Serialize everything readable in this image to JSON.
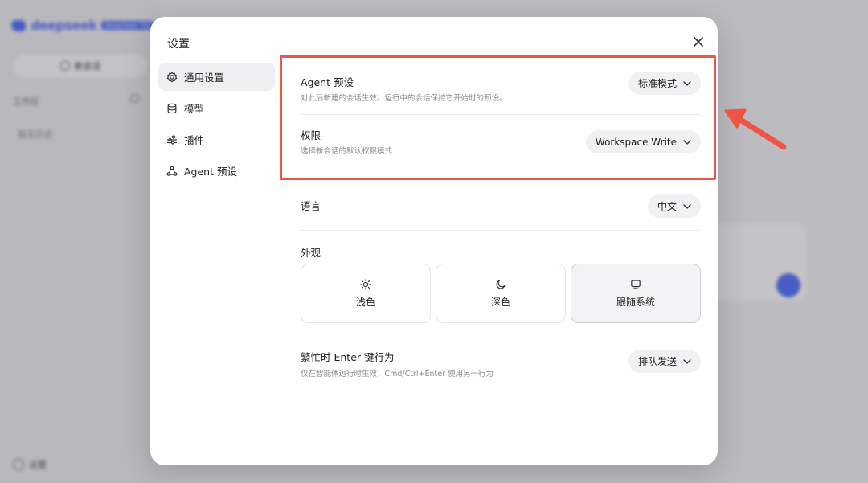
{
  "background": {
    "logo_text": "deepseek",
    "logo_badge": "DeepSeek TUI",
    "new_chat": "新会话",
    "workspace": "工作区",
    "empty": "暂无历史",
    "settings": "设置"
  },
  "modal": {
    "title": "设置",
    "nav": [
      {
        "label": "通用设置",
        "icon": "gear-icon"
      },
      {
        "label": "模型",
        "icon": "database-icon"
      },
      {
        "label": "插件",
        "icon": "sliders-icon"
      },
      {
        "label": "Agent 预设",
        "icon": "agent-icon"
      }
    ],
    "agent_preset": {
      "label": "Agent 预设",
      "desc": "对此后新建的会话生效。运行中的会话保持它开始时的预设。",
      "value": "标准模式"
    },
    "permission": {
      "label": "权限",
      "desc": "选择新会话的默认权限模式",
      "value": "Workspace Write"
    },
    "language": {
      "label": "语言",
      "value": "中文"
    },
    "appearance": {
      "label": "外观",
      "options": [
        {
          "label": "浅色",
          "icon": "sun-icon"
        },
        {
          "label": "深色",
          "icon": "moon-icon"
        },
        {
          "label": "跟随系统",
          "icon": "monitor-icon"
        }
      ],
      "selected": "跟随系统"
    },
    "busy_enter": {
      "label": "繁忙时 Enter 键行为",
      "desc": "仅在智能体运行时生效；Cmd/Ctrl+Enter 使用另一行为",
      "value": "排队发送"
    }
  },
  "colors": {
    "highlight": "#ee5545",
    "accent": "#4d6bfe"
  }
}
